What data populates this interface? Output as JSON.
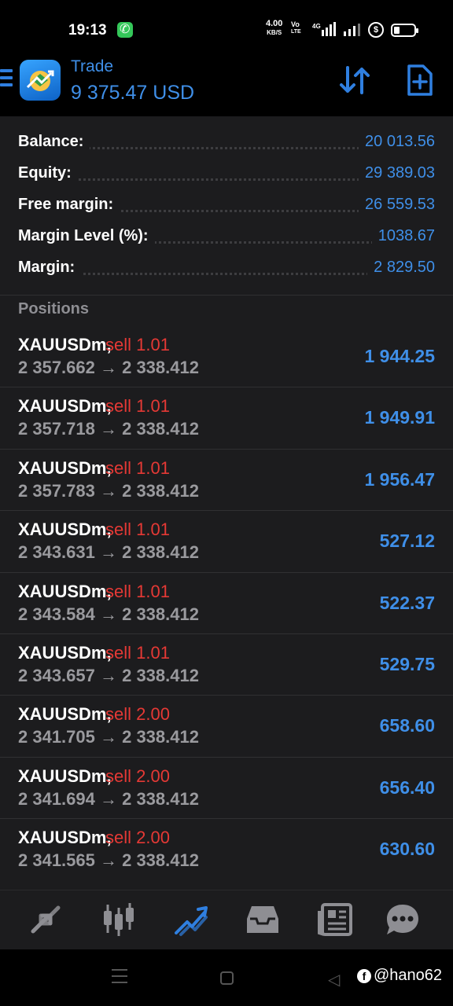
{
  "status_bar": {
    "time": "19:13",
    "net_speed_value": "4.00",
    "net_speed_unit": "KB/S",
    "volte_top": "Vo",
    "volte_bottom": "LTE",
    "network": "4G"
  },
  "header": {
    "title": "Trade",
    "value": "9 375.47 USD",
    "icons": [
      "menu-icon",
      "app-logo",
      "sort-icon",
      "new-order-icon"
    ]
  },
  "account": [
    {
      "label": "Balance:",
      "value": "20 013.56"
    },
    {
      "label": "Equity:",
      "value": "29 389.03"
    },
    {
      "label": "Free margin:",
      "value": "26 559.53"
    },
    {
      "label": "Margin Level (%):",
      "value": "1038.67"
    },
    {
      "label": "Margin:",
      "value": "2 829.50"
    }
  ],
  "positions_label": "Positions",
  "positions": [
    {
      "symbol": "XAUUSDm,",
      "type": "sell 1.01",
      "prices": "2 357.662 → 2 338.412",
      "profit": "1 944.25"
    },
    {
      "symbol": "XAUUSDm,",
      "type": "sell 1.01",
      "prices": "2 357.718 → 2 338.412",
      "profit": "1 949.91"
    },
    {
      "symbol": "XAUUSDm,",
      "type": "sell 1.01",
      "prices": "2 357.783 → 2 338.412",
      "profit": "1 956.47"
    },
    {
      "symbol": "XAUUSDm,",
      "type": "sell 1.01",
      "prices": "2 343.631 → 2 338.412",
      "profit": "527.12"
    },
    {
      "symbol": "XAUUSDm,",
      "type": "sell 1.01",
      "prices": "2 343.584 → 2 338.412",
      "profit": "522.37"
    },
    {
      "symbol": "XAUUSDm,",
      "type": "sell 1.01",
      "prices": "2 343.657 → 2 338.412",
      "profit": "529.75"
    },
    {
      "symbol": "XAUUSDm,",
      "type": "sell 2.00",
      "prices": "2 341.705 → 2 338.412",
      "profit": "658.60"
    },
    {
      "symbol": "XAUUSDm,",
      "type": "sell 2.00",
      "prices": "2 341.694 → 2 338.412",
      "profit": "656.40"
    },
    {
      "symbol": "XAUUSDm,",
      "type": "sell 2.00",
      "prices": "2 341.565 → 2 338.412",
      "profit": "630.60"
    }
  ],
  "tabs": [
    "quotes-icon",
    "chart-icon",
    "trade-icon",
    "history-icon",
    "news-icon",
    "chat-icon"
  ],
  "active_tab": "trade-icon",
  "watermark": "@hano62",
  "colors": {
    "accent": "#3f8fe8",
    "sell": "#e53935",
    "panel": "#1c1c1e"
  }
}
